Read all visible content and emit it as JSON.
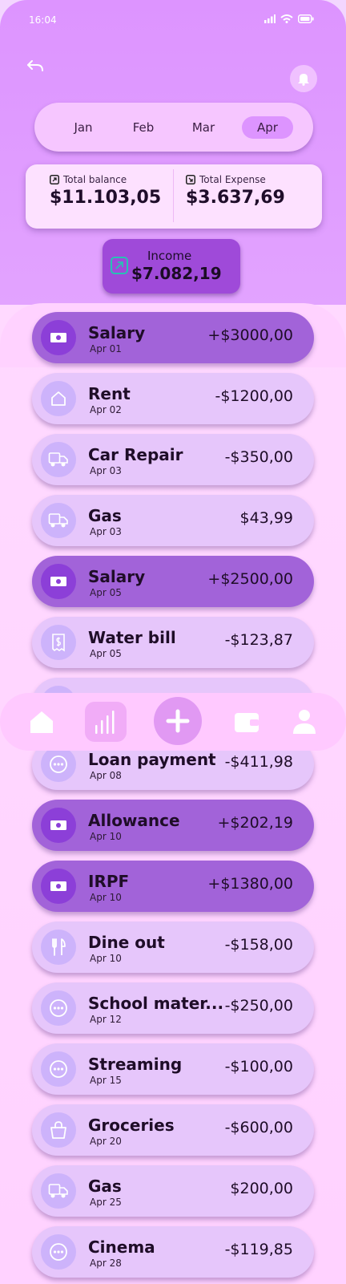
{
  "status_bar": {
    "time": "16:04"
  },
  "colors": {
    "accent": "#dd94ff",
    "income_row": "#a263d9",
    "expense_row": "#e6c6fb",
    "income_card": "#9f4ad9"
  },
  "months": [
    {
      "label": "Jan",
      "active": false
    },
    {
      "label": "Feb",
      "active": false
    },
    {
      "label": "Mar",
      "active": false
    },
    {
      "label": "Apr",
      "active": true
    }
  ],
  "summary": {
    "total_balance_label": "Total balance",
    "total_balance_value": "$11.103,05",
    "total_expense_label": "Total Expense",
    "total_expense_value": "$3.637,69",
    "income_label": "Income",
    "income_value": "$7.082,19"
  },
  "transactions": [
    {
      "name": "Salary",
      "date": "Apr 01",
      "amount": "+$3000,00",
      "type": "income",
      "icon": "cash-icon"
    },
    {
      "name": "Rent",
      "date": "Apr 02",
      "amount": "-$1200,00",
      "type": "expense",
      "icon": "home-icon"
    },
    {
      "name": "Car Repair",
      "date": "Apr 03",
      "amount": "-$350,00",
      "type": "expense",
      "icon": "car-icon"
    },
    {
      "name": "Gas",
      "date": "Apr 03",
      "amount": "$43,99",
      "type": "expense",
      "icon": "car-icon"
    },
    {
      "name": "Salary",
      "date": "Apr 05",
      "amount": "+$2500,00",
      "type": "income",
      "icon": "cash-icon"
    },
    {
      "name": "Water bill",
      "date": "Apr 05",
      "amount": "-$123,87",
      "type": "expense",
      "icon": "receipt-icon"
    },
    {
      "name": "",
      "date": "",
      "amount": "",
      "type": "expense",
      "icon": ""
    },
    {
      "name": "Loan payment",
      "date": "Apr 08",
      "amount": "-$411,98",
      "type": "expense",
      "icon": "more-icon"
    },
    {
      "name": "Allowance",
      "date": "Apr 10",
      "amount": "+$202,19",
      "type": "income",
      "icon": "cash-icon"
    },
    {
      "name": "IRPF",
      "date": "Apr 10",
      "amount": "+$1380,00",
      "type": "income",
      "icon": "cash-icon"
    },
    {
      "name": "Dine out",
      "date": "Apr 10",
      "amount": "-$158,00",
      "type": "expense",
      "icon": "cutlery-icon"
    },
    {
      "name": "School mater...",
      "date": "Apr 12",
      "amount": "-$250,00",
      "type": "expense",
      "icon": "more-icon"
    },
    {
      "name": "Streaming",
      "date": "Apr 15",
      "amount": "-$100,00",
      "type": "expense",
      "icon": "more-icon"
    },
    {
      "name": "Groceries",
      "date": "Apr 20",
      "amount": "-$600,00",
      "type": "expense",
      "icon": "bag-icon"
    },
    {
      "name": "Gas",
      "date": "Apr 25",
      "amount": "$200,00",
      "type": "expense",
      "icon": "car-icon"
    },
    {
      "name": "Cinema",
      "date": "Apr 28",
      "amount": "-$119,85",
      "type": "expense",
      "icon": "more-icon"
    }
  ],
  "bottom_nav": [
    {
      "icon": "home-icon"
    },
    {
      "icon": "stats-icon"
    },
    {
      "icon": "add-icon"
    },
    {
      "icon": "wallet-icon"
    },
    {
      "icon": "profile-icon"
    }
  ]
}
